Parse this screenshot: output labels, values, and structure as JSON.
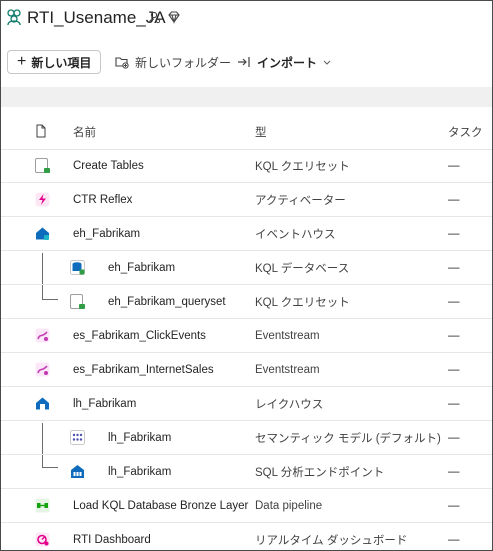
{
  "header": {
    "title": "RTI_Usename_JA"
  },
  "toolbar": {
    "new_item": "新しい項目",
    "new_folder": "新しいフォルダー",
    "import": "インポート"
  },
  "table": {
    "columns": {
      "name": "名前",
      "type": "型",
      "task": "タスク"
    },
    "rows": [
      {
        "name": "Create Tables",
        "type": "KQL クエリセット",
        "task": "—",
        "icon": "kql-queryset-icon",
        "color": "#2f9e44"
      },
      {
        "name": "CTR Reflex",
        "type": "アクティベーター",
        "task": "—",
        "icon": "activator-icon",
        "color": "#e3008c"
      },
      {
        "name": "eh_Fabrikam",
        "type": "イベントハウス",
        "task": "—",
        "icon": "eventhouse-icon",
        "color": "#0f6cbd"
      },
      {
        "name": "eh_Fabrikam",
        "type": "KQL データベース",
        "task": "—",
        "icon": "kql-database-icon",
        "color": "#0f6cbd"
      },
      {
        "name": "eh_Fabrikam_queryset",
        "type": "KQL クエリセット",
        "task": "—",
        "icon": "kql-queryset-icon",
        "color": "#2f9e44"
      },
      {
        "name": "es_Fabrikam_ClickEvents",
        "type": "Eventstream",
        "task": "—",
        "icon": "eventstream-icon",
        "color": "#c239b3"
      },
      {
        "name": "es_Fabrikam_InternetSales",
        "type": "Eventstream",
        "task": "—",
        "icon": "eventstream-icon",
        "color": "#c239b3"
      },
      {
        "name": "lh_Fabrikam",
        "type": "レイクハウス",
        "task": "—",
        "icon": "lakehouse-icon",
        "color": "#0f6cbd"
      },
      {
        "name": "lh_Fabrikam",
        "type": "セマンティック モデル (デフォルト)",
        "task": "—",
        "icon": "semantic-model-icon",
        "color": "#4f52b2"
      },
      {
        "name": "lh_Fabrikam",
        "type": "SQL 分析エンドポイント",
        "task": "—",
        "icon": "sql-endpoint-icon",
        "color": "#0f6cbd"
      },
      {
        "name": "Load KQL Database Bronze Layer",
        "type": "Data pipeline",
        "task": "—",
        "icon": "pipeline-icon",
        "color": "#13a10e"
      },
      {
        "name": "RTI Dashboard",
        "type": "リアルタイム ダッシュボード",
        "task": "—",
        "icon": "dashboard-icon",
        "color": "#e3008c"
      }
    ]
  }
}
